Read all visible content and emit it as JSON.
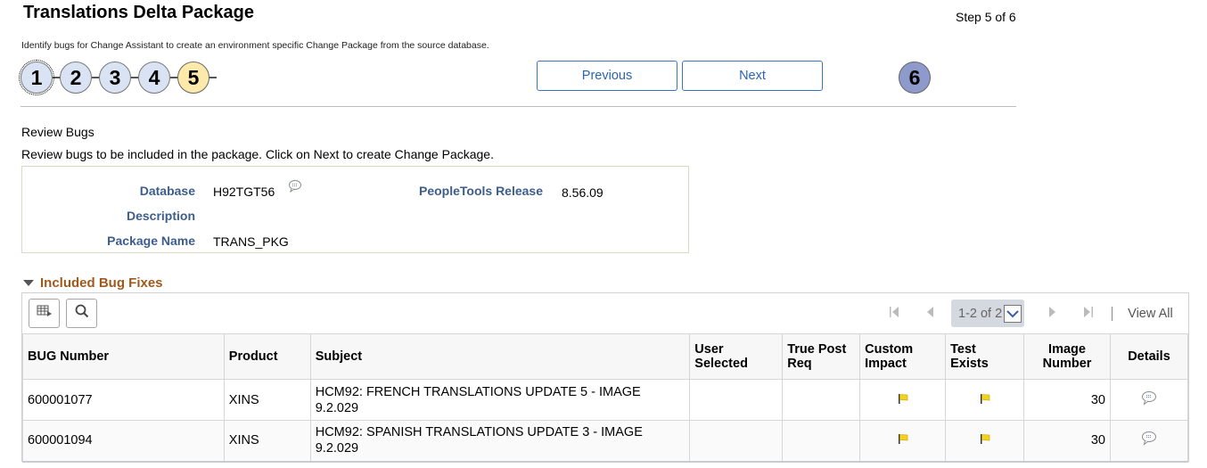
{
  "header": {
    "title": "Translations Delta Package",
    "step_indicator": "Step 5 of 6",
    "instructions": "Identify bugs for Change Assistant to create an environment specific Change Package from the source database."
  },
  "steps": [
    {
      "label": "1",
      "state": "completed"
    },
    {
      "label": "2",
      "state": "completed"
    },
    {
      "label": "3",
      "state": "completed"
    },
    {
      "label": "4",
      "state": "completed"
    },
    {
      "label": "5",
      "state": "current"
    },
    {
      "label": "6",
      "state": "upcoming"
    }
  ],
  "navigation": {
    "previous_label": "Previous",
    "next_label": "Next"
  },
  "review": {
    "title": "Review Bugs",
    "description": "Review bugs to be included in the package.  Click on Next to create Change Package."
  },
  "info": {
    "database_label": "Database",
    "database_value": "H92TGT56",
    "description_label": "Description",
    "description_value": "",
    "package_name_label": "Package Name",
    "package_name_value": "TRANS_PKG",
    "peopletools_label": "PeopleTools Release",
    "peopletools_value": "8.56.09"
  },
  "section": {
    "title": "Included Bug Fixes",
    "expanded": true
  },
  "grid": {
    "pager": {
      "count_label": "1-2 of 2",
      "view_all_label": "View All"
    },
    "columns": [
      "BUG Number",
      "Product",
      "Subject",
      "User Selected",
      "True Post Req",
      "Custom Impact",
      "Test Exists",
      "Image Number",
      "Details"
    ],
    "rows": [
      {
        "bug_number": "600001077",
        "product": "XINS",
        "subject_line1": "HCM92: FRENCH TRANSLATIONS UPDATE 5 - IMAGE",
        "subject_line2": "9.2.029",
        "user_selected": "",
        "true_post_req": "",
        "custom_impact": "flag",
        "test_exists": "flag",
        "image_number": "30",
        "details": "details-icon"
      },
      {
        "bug_number": "600001094",
        "product": "XINS",
        "subject_line1": "HCM92: SPANISH TRANSLATIONS UPDATE 3 - IMAGE",
        "subject_line2": "9.2.029",
        "user_selected": "",
        "true_post_req": "",
        "custom_impact": "flag",
        "test_exists": "flag",
        "image_number": "30",
        "details": "details-icon"
      }
    ]
  },
  "colors": {
    "label_blue": "#3d5d8c",
    "section_orange": "#a0591c",
    "button_blue": "#2a64b4",
    "step_completed": "#dae3f3",
    "step_current": "#fde9a9",
    "step_upcoming": "#8e99cc",
    "flag_yellow": "#f2d21e"
  }
}
